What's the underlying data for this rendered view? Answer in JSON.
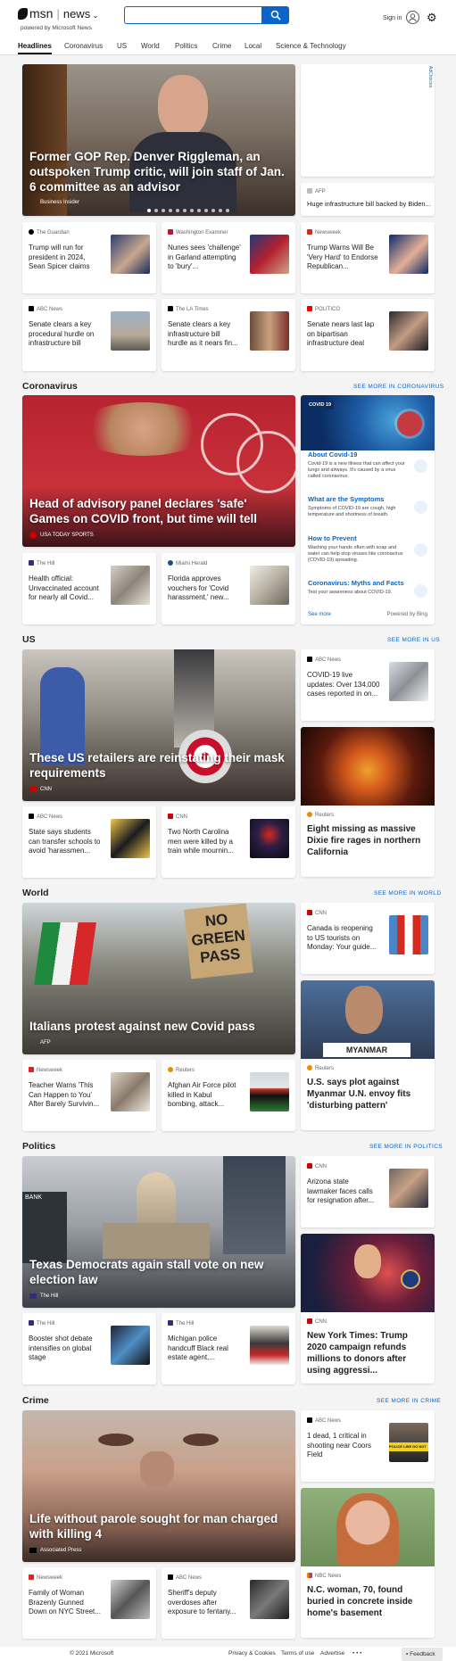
{
  "header": {
    "brand": "msn",
    "section": "news",
    "chevron": "⌄",
    "powered": "powered by Microsoft News",
    "search_placeholder": "",
    "signin": "Sign in"
  },
  "nav": [
    "Headlines",
    "Coronavirus",
    "US",
    "World",
    "Politics",
    "Crime",
    "Local",
    "Science & Technology"
  ],
  "top": {
    "hero": {
      "title": "Former GOP Rep. Denver Riggleman, an outspoken Trump critic, will join staff of Jan. 6 committee as an advisor",
      "source": "Business Insider"
    },
    "ad": {
      "choices": "AdChoices",
      "source": "AFP",
      "title": "Huge infrastructure bill backed by Biden..."
    },
    "row1": [
      {
        "source": "The Guardian",
        "title": "Trump will run for president in 2024, Sean Spicer claims"
      },
      {
        "source": "Washington Examiner",
        "title": "Nunes sees 'challenge' in Garland attempting to 'bury'..."
      },
      {
        "source": "Newsweek",
        "title": "Trump Warns Will Be 'Very Hard' to Endorse Republican..."
      }
    ],
    "row2": [
      {
        "source": "ABC News",
        "title": "Senate clears a key procedural hurdle on infrastructure bill"
      },
      {
        "source": "The LA Times",
        "title": "Senate clears a key infrastructure bill hurdle as it nears fin..."
      },
      {
        "source": "POLITICO",
        "title": "Senate nears last lap on bipartisan infrastructure deal"
      }
    ]
  },
  "coronavirus": {
    "title": "Coronavirus",
    "see_more": "SEE MORE IN CORONAVIRUS",
    "hero": {
      "title": "Head of advisory panel declares 'safe' Games on COVID front, but time will tell",
      "source": "USA TODAY SPORTS"
    },
    "cards": [
      {
        "source": "The Hill",
        "title": "Health official: Unvaccinated account for nearly all Covid..."
      },
      {
        "source": "Miami Herald",
        "title": "Florida approves vouchers for 'Covid harassment,' new..."
      }
    ],
    "panel": {
      "badge": "COVID 19",
      "items": [
        {
          "t": "About Covid-19",
          "d": "Covid-19 is a new illness that can affect your lungs and airways. It's caused by a virus called coronavirus."
        },
        {
          "t": "What are the Symptoms",
          "d": "Symptoms of COVID-19 are cough, high temperature and shortness of breath."
        },
        {
          "t": "How to Prevent",
          "d": "Washing your hands often with soap and water can help stop viruses like coronavirus (COVID-19) spreading."
        },
        {
          "t": "Coronavirus: Myths and Facts",
          "d": "Test your awareness about COVID-19."
        }
      ],
      "see_more": "See more",
      "powered": "Powered by Bing"
    }
  },
  "us": {
    "title": "US",
    "see_more": "SEE MORE IN US",
    "hero": {
      "title": "These US retailers are reinstating their mask requirements",
      "source": "CNN"
    },
    "side1": {
      "source": "ABC News",
      "title": "COVID-19 live updates: Over 134,000 cases reported in on..."
    },
    "side2": {
      "source": "Reuters",
      "title": "Eight missing as massive Dixie fire rages in northern California"
    },
    "cards": [
      {
        "source": "ABC News",
        "title": "State says students can transfer schools to avoid 'harassmen..."
      },
      {
        "source": "CNN",
        "title": "Two North Carolina men were killed by a train while mournin..."
      }
    ]
  },
  "world": {
    "title": "World",
    "see_more": "SEE MORE IN WORLD",
    "hero": {
      "title": "Italians protest against new Covid pass",
      "source": "AFP",
      "sign": "NO GREEN PASS"
    },
    "side1": {
      "source": "CNN",
      "title": "Canada is reopening to US tourists on Monday: Your guide..."
    },
    "side2": {
      "source": "Reuters",
      "title": "U.S. says plot against Myanmar U.N. envoy fits 'disturbing pattern'",
      "sign": "MYANMAR"
    },
    "cards": [
      {
        "source": "Newsweek",
        "title": "Teacher Warns 'This Can Happen to You' After Barely Survivin..."
      },
      {
        "source": "Reuters",
        "title": "Afghan Air Force pilot killed in Kabul bombing, attack..."
      }
    ]
  },
  "politics": {
    "title": "Politics",
    "see_more": "SEE MORE IN POLITICS",
    "hero": {
      "title": "Texas Democrats again stall vote on new election law",
      "source": "The Hill"
    },
    "side1": {
      "source": "CNN",
      "title": "Arizona state lawmaker faces calls for resignation after..."
    },
    "side2": {
      "source": "CNN",
      "title": "New York Times: Trump 2020 campaign refunds millions to donors after using aggressi..."
    },
    "cards": [
      {
        "source": "The Hill",
        "title": "Booster shot debate intensifies on global stage"
      },
      {
        "source": "The Hill",
        "title": "Michigan police handcuff Black real estate agent,..."
      }
    ]
  },
  "crime": {
    "title": "Crime",
    "see_more": "SEE MORE IN CRIME",
    "hero": {
      "title": "Life without parole sought for man charged with killing 4",
      "source": "Associated Press"
    },
    "side1": {
      "source": "ABC News",
      "title": "1 dead, 1 critical in shooting near Coors Field",
      "tape": "POLICE LINE DO NOT"
    },
    "side2": {
      "source": "NBC News",
      "title": "N.C. woman, 70, found buried in concrete inside home's basement"
    },
    "cards": [
      {
        "source": "Newsweek",
        "title": "Family of Woman Brazenly Gunned Down on NYC Street..."
      },
      {
        "source": "ABC News",
        "title": "Sheriff's deputy overdoses after exposure to fentany..."
      }
    ]
  },
  "footer": {
    "copyright": "© 2021 Microsoft",
    "privacy": "Privacy & Cookies",
    "terms": "Terms of use",
    "advertise": "Advertise",
    "more": "• • •",
    "feedback": "Feedback"
  },
  "colors": {
    "accent": "#0a64ca",
    "cnn": "#cc0000"
  }
}
